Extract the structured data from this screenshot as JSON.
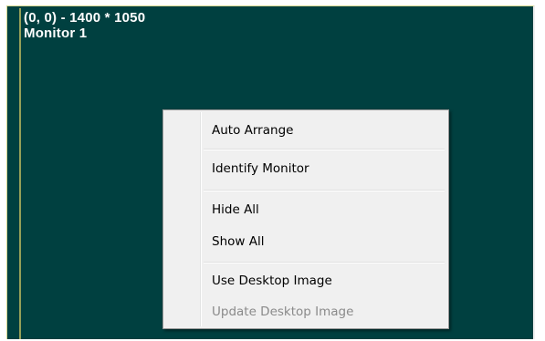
{
  "monitor": {
    "resolution_label": "(0, 0) - 1400 * 1050",
    "name_label": "Monitor 1",
    "background_color": "#004040"
  },
  "context_menu": {
    "items": [
      {
        "label": "Auto Arrange",
        "enabled": true
      },
      {
        "label": "Identify Monitor",
        "enabled": true
      },
      {
        "label": "Hide All",
        "enabled": true
      },
      {
        "label": "Show All",
        "enabled": true
      },
      {
        "label": "Use Desktop Image",
        "enabled": true
      },
      {
        "label": "Update Desktop Image",
        "enabled": false
      }
    ]
  }
}
